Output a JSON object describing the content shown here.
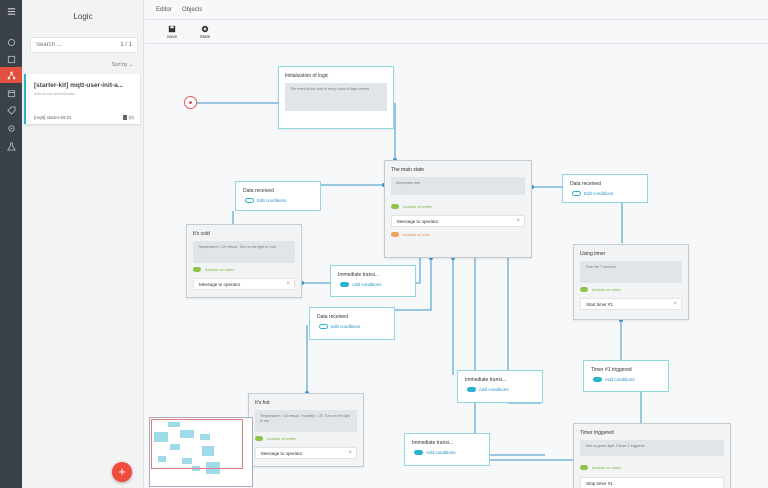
{
  "sidebar_icons": [
    "menu-icon",
    "palette-icon",
    "list-icon",
    "logic-icon",
    "calendar-icon",
    "tag-icon",
    "puzzle-icon",
    "flask-icon"
  ],
  "panel": {
    "title": "Logic",
    "search_placeholder": "Search ...",
    "search_count": "1 / 1",
    "sort_label": "Sort by",
    "card": {
      "title": "[starter-kit] mqtt-user-init-a...",
      "subtitle": "write device authentication",
      "tag": "[mqtt] starter-kit-01",
      "count": "(0)"
    }
  },
  "tabs": [
    "Editor",
    "Objects"
  ],
  "toolbar": {
    "save_label": "Save",
    "state_label": "State"
  },
  "nodes": {
    "init": {
      "title": "Initialization of logic",
      "desc": "The event at the start of every chain of logic events"
    },
    "main": {
      "title": "The main state",
      "desc": "Description text",
      "on_enter": "Actions on enter",
      "action": "Message to operator",
      "on_exit": "Actions on exit"
    },
    "cold": {
      "title": "It's cold",
      "desc": "Temperature < 15 celsius. Turn on the light to cold",
      "on_enter": "Actions on enter",
      "action": "Message to operator"
    },
    "hot": {
      "title": "It's hot",
      "desc": "Temperature > 30 celsius. Humidity > 20. Turn on the light to red",
      "on_enter": "Actions on enter",
      "action": "Message to operator"
    },
    "timer": {
      "title": "Using timer",
      "desc": "Timer for 7 seconds",
      "on_enter": "Actions on enter",
      "action": "Start timer #1"
    },
    "triggered": {
      "title": "Timer triggered",
      "desc": "Turn on green light. If timer 1 triggered",
      "on_enter": "Actions on enter",
      "action": "Stop timer #1"
    }
  },
  "transitions": {
    "dr_left": {
      "title": "Data received",
      "link": "Edit conditions"
    },
    "dr_right": {
      "title": "Data received",
      "link": "Edit conditions"
    },
    "dr_mid": {
      "title": "Data received",
      "link": "Edit conditions"
    },
    "imm1": {
      "title": "Immediate transi...",
      "link": "Add conditions"
    },
    "imm2": {
      "title": "Immediate transi...",
      "link": "Add conditions"
    },
    "imm3": {
      "title": "Immediate transi...",
      "link": "Add conditions"
    },
    "timer_trig": {
      "title": "Timer #1 triggered",
      "link": "Add conditions"
    }
  },
  "fab_label": "+",
  "colors": {
    "accent": "#27b5c6",
    "danger": "#ef4c3c",
    "rail": "#3b4148",
    "wire": "#3a93c9"
  }
}
